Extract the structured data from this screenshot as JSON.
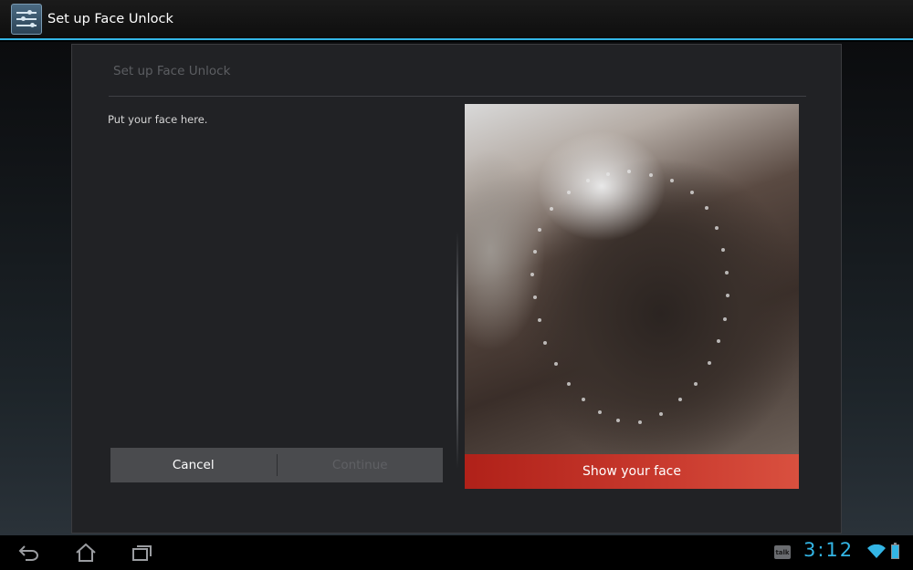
{
  "action_bar": {
    "icon": "settings-sliders-icon",
    "title": "Set up Face Unlock"
  },
  "dialog": {
    "title": "Set up Face Unlock",
    "instruction": "Put your face here.",
    "camera": {
      "status_label": "Show your face",
      "status_color": "#c93a2e"
    },
    "buttons": {
      "cancel_label": "Cancel",
      "continue_label": "Continue"
    }
  },
  "system_bar": {
    "nav": [
      "back-icon",
      "home-icon",
      "recent-apps-icon"
    ],
    "notification_icon_label": "talk",
    "clock": "3:12",
    "accent_color": "#33b5e5"
  }
}
